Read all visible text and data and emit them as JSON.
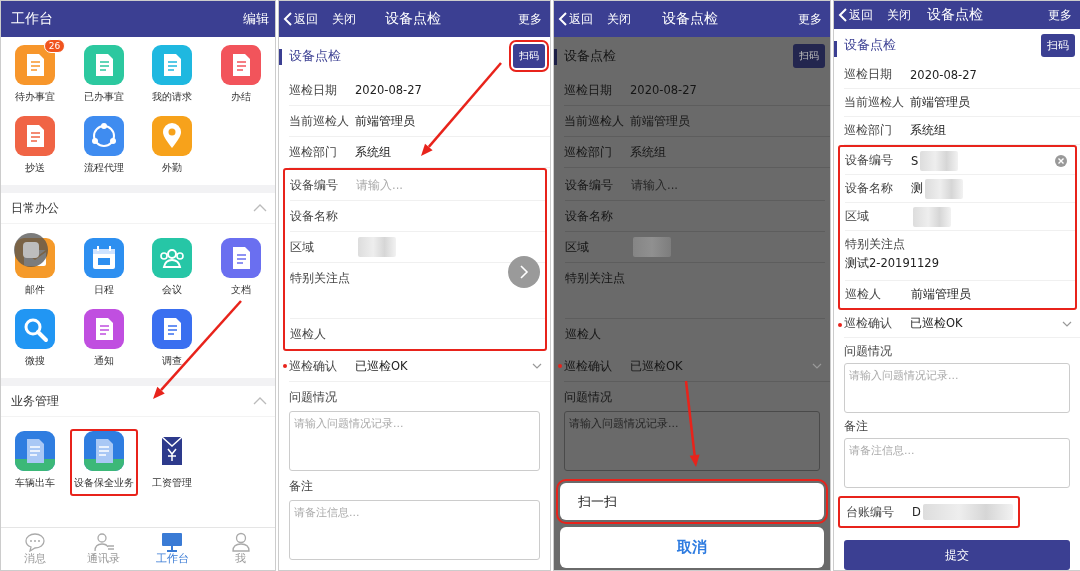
{
  "workbench": {
    "title": "工作台",
    "edit": "编辑",
    "floating_button": true,
    "apps": [
      {
        "label": "待办事宜",
        "kind": "todo",
        "color": "#f7962b",
        "badge": "26",
        "highlighted": false
      },
      {
        "label": "已办事宜",
        "kind": "done",
        "color": "#2cc89f",
        "highlighted": false
      },
      {
        "label": "我的请求",
        "kind": "request",
        "color": "#1fb8e0",
        "highlighted": false
      },
      {
        "label": "办结",
        "kind": "form",
        "color": "#f2545b",
        "highlighted": false
      },
      {
        "label": "抄送",
        "kind": "send",
        "color": "#f06445",
        "highlighted": false
      },
      {
        "label": "流程代理",
        "kind": "cycle",
        "color": "#3f8cf0",
        "highlighted": false
      },
      {
        "label": "外勤",
        "kind": "pin",
        "color": "#f7a21b",
        "highlighted": false
      }
    ],
    "sections": [
      {
        "title": "日常办公",
        "expanded": true,
        "apps": [
          {
            "label": "邮件",
            "kind": "mail",
            "color": "#f59a2a",
            "highlighted": false
          },
          {
            "label": "日程",
            "kind": "calendar",
            "color": "#2d8ff0",
            "highlighted": false
          },
          {
            "label": "会议",
            "kind": "people",
            "color": "#26c6a6",
            "highlighted": false
          },
          {
            "label": "文档",
            "kind": "form",
            "color": "#6a6ff0",
            "highlighted": false
          },
          {
            "label": "微搜",
            "kind": "search",
            "color": "#2196f3",
            "highlighted": false
          },
          {
            "label": "通知",
            "kind": "news",
            "color": "#c04fe0",
            "highlighted": false
          },
          {
            "label": "调查",
            "kind": "survey",
            "color": "#3a6ff0",
            "highlighted": false
          }
        ]
      },
      {
        "title": "业务管理",
        "expanded": true,
        "apps": [
          {
            "label": "车辆出车",
            "kind": "file",
            "color": "#2f7de0",
            "highlighted": false
          },
          {
            "label": "设备保全业务",
            "kind": "file",
            "color": "#2f7de0",
            "highlighted": true
          },
          {
            "label": "工资管理",
            "kind": "envelope",
            "color": "#2d3a8c",
            "highlighted": false
          }
        ]
      }
    ],
    "tabbar": [
      {
        "label": "消息",
        "kind": "chat",
        "selected": false
      },
      {
        "label": "通讯录",
        "kind": "contacts",
        "selected": false
      },
      {
        "label": "工作台",
        "kind": "monitor",
        "selected": true
      },
      {
        "label": "我",
        "kind": "person",
        "selected": false
      }
    ]
  },
  "screens": [
    {
      "nav": {
        "back": "返回",
        "close": "关闭",
        "title": "设备点检",
        "more": "更多"
      },
      "heading": "设备点检",
      "scan": {
        "label": "扫码",
        "highlighted": true
      },
      "floating_button": true,
      "dimmed": false,
      "inspection": [
        {
          "label": "巡检日期",
          "value": "2020-08-27"
        },
        {
          "label": "当前巡检人",
          "value": "前端管理员"
        },
        {
          "label": "巡检部门",
          "value": "系统组"
        }
      ],
      "device": {
        "highlighted": true,
        "fields": [
          {
            "label": "设备编号",
            "kind": "inline",
            "placeholder": "请输入...",
            "redacted": false,
            "clearable": false
          },
          {
            "label": "设备名称",
            "kind": "inline",
            "redacted": false,
            "clearable": false
          },
          {
            "label": "区域",
            "kind": "inline",
            "redacted": true,
            "clearable": false
          },
          {
            "label": "特别关注点",
            "kind": "stacked",
            "redacted": false,
            "clearable": false
          },
          {
            "label": "巡检人",
            "kind": "inline",
            "redacted": false,
            "clearable": false
          }
        ]
      },
      "confirm": {
        "label": "巡检确认",
        "value": "已巡检OK",
        "required": true
      },
      "problem": {
        "label": "问题情况",
        "placeholder": "请输入问题情况记录..."
      },
      "remark": {
        "label": "备注",
        "placeholder": "请备注信息..."
      }
    },
    {
      "nav": {
        "back": "返回",
        "close": "关闭",
        "title": "设备点检",
        "more": "更多"
      },
      "heading": "设备点检",
      "scan": {
        "label": "扫码",
        "highlighted": false
      },
      "floating_button": false,
      "dimmed": true,
      "inspection": [
        {
          "label": "巡检日期",
          "value": "2020-08-27"
        },
        {
          "label": "当前巡检人",
          "value": "前端管理员"
        },
        {
          "label": "巡检部门",
          "value": "系统组"
        }
      ],
      "device": {
        "highlighted": false,
        "fields": [
          {
            "label": "设备编号",
            "kind": "inline",
            "placeholder": "请输入...",
            "redacted": false,
            "clearable": false
          },
          {
            "label": "设备名称",
            "kind": "inline",
            "redacted": false,
            "clearable": false
          },
          {
            "label": "区域",
            "kind": "inline",
            "redacted": true,
            "clearable": false
          },
          {
            "label": "特别关注点",
            "kind": "stacked",
            "redacted": false,
            "clearable": false
          },
          {
            "label": "巡检人",
            "kind": "inline",
            "redacted": false,
            "clearable": false
          }
        ]
      },
      "confirm": {
        "label": "巡检确认",
        "value": "已巡检OK",
        "required": true
      },
      "problem": {
        "label": "问题情况",
        "placeholder": "请输入问题情况记录..."
      },
      "sheet": [
        {
          "label": "扫一扫",
          "kind": "action",
          "highlighted": true
        },
        {
          "label": "取消",
          "kind": "cancel",
          "highlighted": false
        }
      ]
    },
    {
      "nav": {
        "back": "返回",
        "close": "关闭",
        "title": "设备点检",
        "more": "更多"
      },
      "heading": "设备点检",
      "scan": {
        "label": "扫码",
        "highlighted": false
      },
      "floating_button": false,
      "dimmed": false,
      "inspection": [
        {
          "label": "巡检日期",
          "value": "2020-08-27"
        },
        {
          "label": "当前巡检人",
          "value": "前端管理员"
        },
        {
          "label": "巡检部门",
          "value": "系统组"
        }
      ],
      "device": {
        "highlighted": true,
        "fields": [
          {
            "label": "设备编号",
            "kind": "inline",
            "value": "S",
            "redacted": true,
            "clearable": true
          },
          {
            "label": "设备名称",
            "kind": "inline",
            "value": "测",
            "redacted": true,
            "clearable": false
          },
          {
            "label": "区域",
            "kind": "inline",
            "redacted": true,
            "clearable": false
          },
          {
            "label": "特别关注点",
            "kind": "stacked",
            "value": "测试2-20191129",
            "redacted": false,
            "clearable": false
          },
          {
            "label": "巡检人",
            "kind": "inline",
            "value": "前端管理员",
            "redacted": false,
            "clearable": false
          }
        ]
      },
      "confirm": {
        "label": "巡检确认",
        "value": "已巡检OK",
        "required": true
      },
      "problem": {
        "label": "问题情况",
        "placeholder": "请输入问题情况记录..."
      },
      "remark": {
        "label": "备注",
        "placeholder": "请备注信息..."
      },
      "ledger": {
        "label": "台账编号",
        "value": "D",
        "redacted": true,
        "highlighted": true
      },
      "submit": "提交"
    }
  ]
}
